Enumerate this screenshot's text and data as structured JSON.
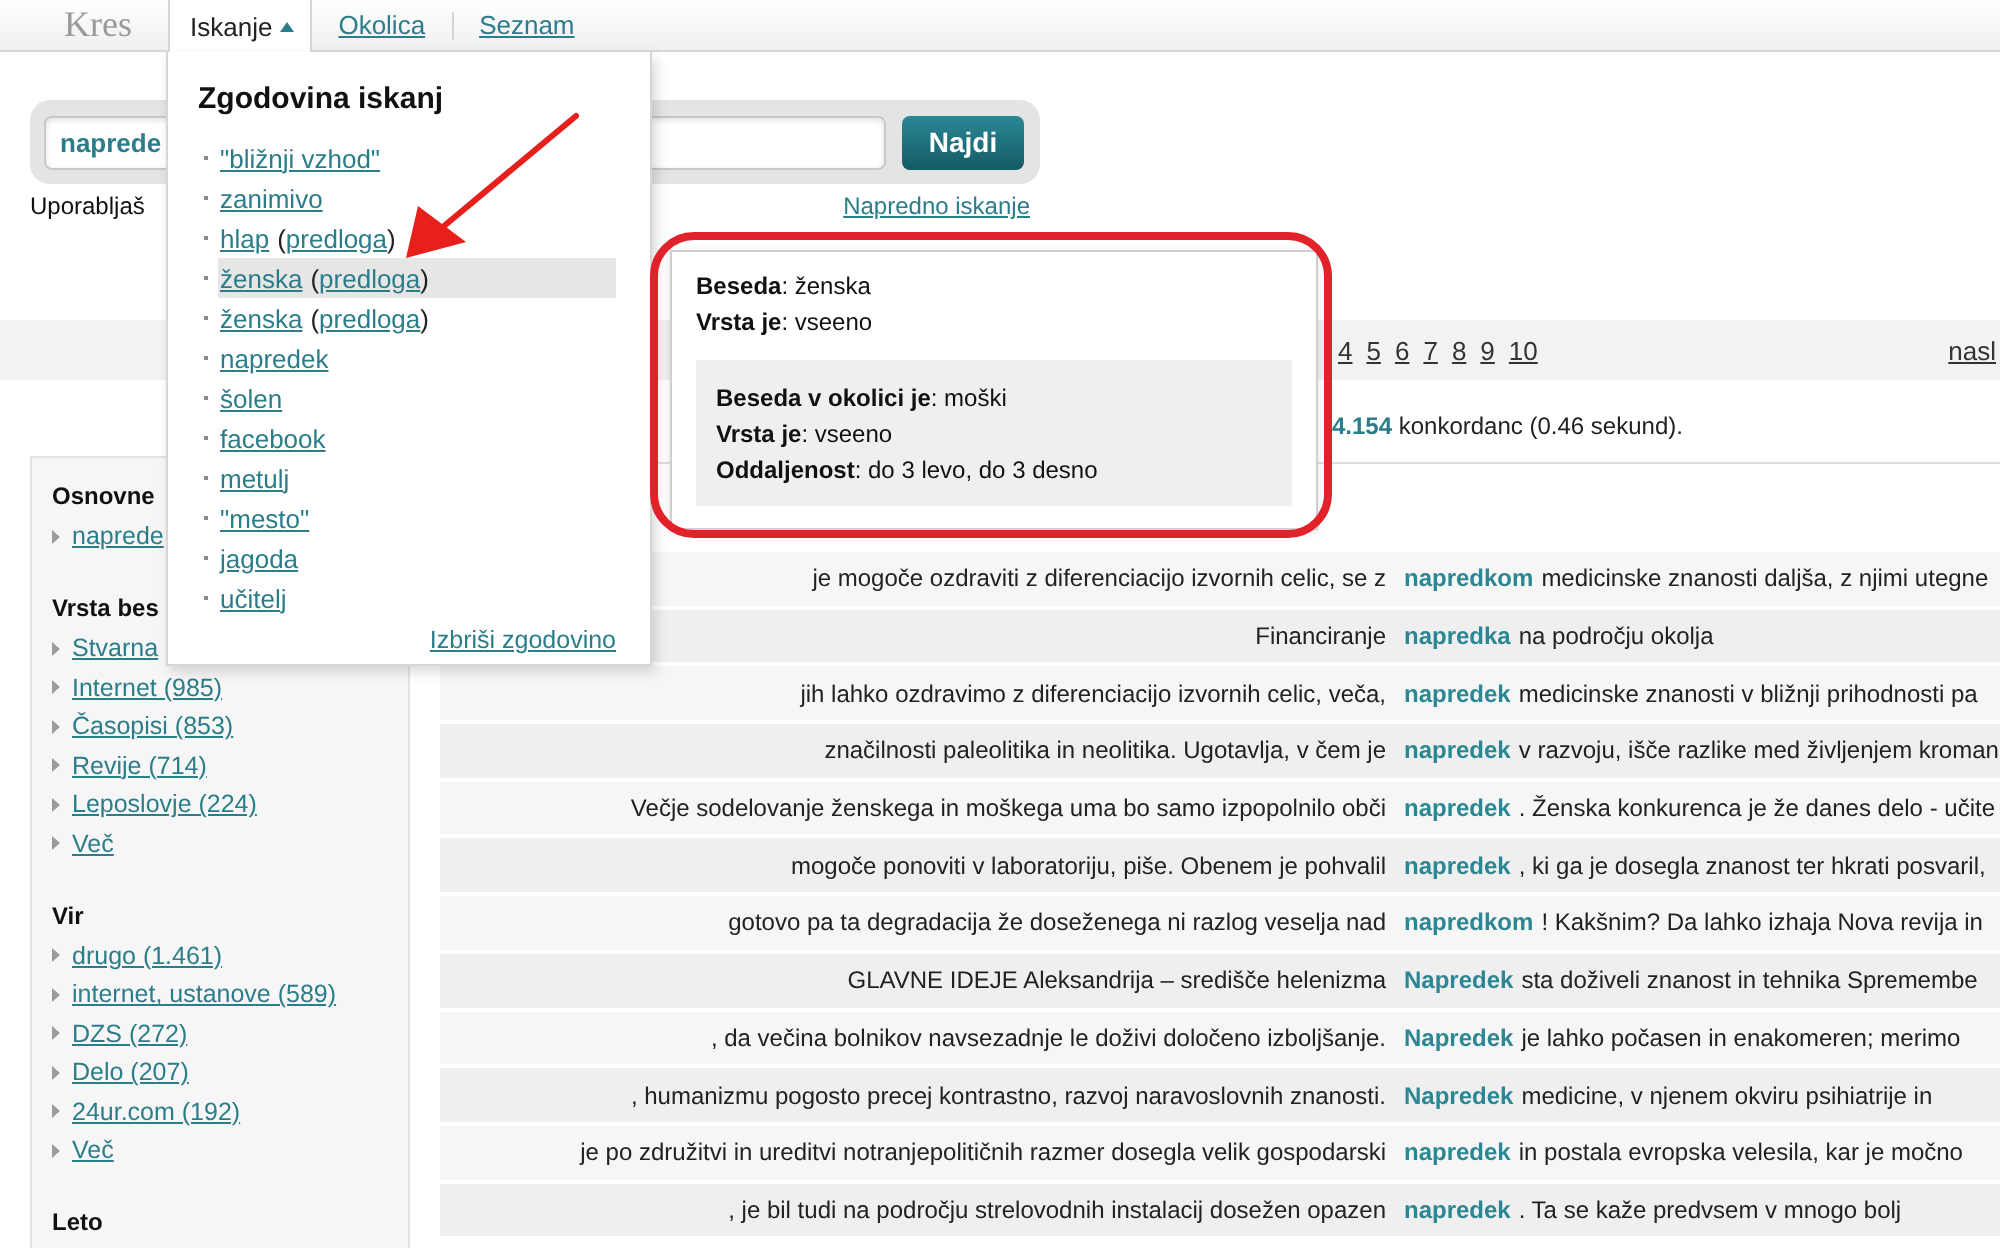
{
  "nav": {
    "logo": "Kres",
    "tabs": [
      {
        "label": "Iskanje",
        "selected": true,
        "expanded": true
      },
      {
        "label": "Okolica",
        "selected": false
      },
      {
        "label": "Seznam",
        "selected": false
      }
    ]
  },
  "search": {
    "value": "naprede",
    "button": "Najdi",
    "note": "Uporabljaš",
    "advanced_link": "Napredno iskanje"
  },
  "history": {
    "title": "Zgodovina iskanj",
    "items": [
      {
        "label": "\"bližnji vzhod\"",
        "selected": false
      },
      {
        "label": "zanimivo",
        "selected": false
      },
      {
        "label": "hlap",
        "template": {
          "open": "(",
          "label": "predloga",
          "close": ")"
        },
        "selected": false
      },
      {
        "label": "ženska",
        "template": {
          "open": "(",
          "label": "predloga",
          "close": ")"
        },
        "selected": true
      },
      {
        "label": "ženska",
        "template": {
          "open": "(",
          "label": "predloga",
          "close": ")"
        },
        "selected": false
      },
      {
        "label": "napredek",
        "selected": false
      },
      {
        "label": "šolen",
        "selected": false
      },
      {
        "label": "facebook",
        "selected": false
      },
      {
        "label": "metulj",
        "selected": false
      },
      {
        "label": "\"mesto\"",
        "selected": false
      },
      {
        "label": "jagoda",
        "selected": false
      },
      {
        "label": "učitelj",
        "selected": false
      }
    ],
    "clear": "Izbriši zgodovino"
  },
  "tooltip": {
    "lines": [
      "**Beseda**: ženska",
      "**Vrsta je**: vseeno"
    ],
    "context": [
      "**Beseda v okolici je**: moški",
      "**Vrsta je**: vseeno",
      "**Oddaljenost**: do 3 levo, do 3 desno"
    ]
  },
  "pagination": {
    "pages": [
      {
        "label": "4",
        "selected": false
      },
      {
        "label": "5",
        "selected": false
      },
      {
        "label": "6",
        "selected": false
      },
      {
        "label": "7",
        "selected": false
      },
      {
        "label": "8",
        "selected": false
      },
      {
        "label": "9",
        "selected": false
      },
      {
        "label": "10",
        "selected": false
      }
    ],
    "next": "nasl"
  },
  "results": "**4.154** konkordanc (0.46 sekund).",
  "sidebar": {
    "sections": [
      {
        "title": "Osnovne",
        "items": [
          "naprede"
        ]
      },
      {
        "title": "Vrsta bes",
        "items": [
          "Stvarna",
          "Internet (985)",
          "Časopisi (853)",
          "Revije (714)",
          "Leposlovje (224)",
          "Več"
        ]
      },
      {
        "title": "Vir",
        "items": [
          "drugo (1.461)",
          "internet, ustanove (589)",
          "DZS (272)",
          "Delo (207)",
          "24ur.com (192)",
          "Več"
        ]
      },
      {
        "title": "Leto"
      }
    ]
  },
  "concordance": {
    "rows": [
      {
        "left": "je mogoče ozdraviti z diferenciacijo izvornih celic, se z",
        "keyword": "napredkom",
        "right": "medicinske znanosti daljša, z njimi utegne"
      },
      {
        "left": "Financiranje",
        "keyword": "napredka",
        "right": "na področju okolja"
      },
      {
        "left": "jih lahko ozdravimo z diferenciacijo izvornih celic, veča,",
        "keyword": "napredek",
        "right": "medicinske znanosti v bližnji prihodnosti pa"
      },
      {
        "left": "značilnosti paleolitika in neolitika. Ugotavlja, v čem je",
        "keyword": "napredek",
        "right": "v razvoju, išče razlike med življenjem kroman"
      },
      {
        "left": "Večje sodelovanje ženskega in moškega uma bo samo izpopolnilo obči",
        "keyword": "napredek",
        "right": ". Ženska konkurenca je že danes delo - učite"
      },
      {
        "left": "mogoče ponoviti v laboratoriju, piše. Obenem je pohvalil",
        "keyword": "napredek",
        "right": ", ki ga je dosegla znanost ter hkrati posvaril,"
      },
      {
        "left": "gotovo pa ta degradacija že doseženega ni razlog veselja nad",
        "keyword": "napredkom",
        "right": "! Kakšnim? Da lahko izhaja Nova revija in"
      },
      {
        "left": "GLAVNE IDEJE Aleksandrija – središče helenizma",
        "keyword": "Napredek",
        "right": "sta doživeli znanost in tehnika Spremembe"
      },
      {
        "left": ", da večina bolnikov navsezadnje le doživi določeno izboljšanje.",
        "keyword": "Napredek",
        "right": "je lahko počasen in enakomeren; merimo"
      },
      {
        "left": ", humanizmu pogosto precej kontrastno, razvoj naravoslovnih znanosti.",
        "keyword": "Napredek",
        "right": "medicine, v njenem okviru psihiatrije in"
      },
      {
        "left": "je po združitvi in ureditvi notranjepolitičnih razmer dosegla velik gospodarski",
        "keyword": "napredek",
        "right": "in postala evropska velesila, kar je močno"
      },
      {
        "left": ", je bil tudi na področju strelovodnih instalacij dosežen opazen",
        "keyword": "napredek",
        "right": ". Ta se kaže predvsem v mnogo bolj"
      }
    ]
  }
}
